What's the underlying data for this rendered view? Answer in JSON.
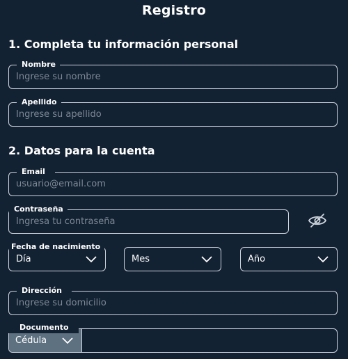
{
  "header": {
    "title": "Registro"
  },
  "sections": {
    "personal": "1. Completa tu información personal",
    "account": "2. Datos para la cuenta"
  },
  "fields": {
    "nombre": {
      "label": "Nombre",
      "placeholder": "Ingrese su nombre"
    },
    "apellido": {
      "label": "Apellido",
      "placeholder": "Ingrese su apellido"
    },
    "email": {
      "label": "Email",
      "placeholder": "usuario@email.com"
    },
    "password": {
      "label": "Contraseña",
      "placeholder": "Ingresa tu contraseña"
    },
    "birth": {
      "label": "Fecha de nacimiento",
      "day": "Día",
      "month": "Mes",
      "year": "Año"
    },
    "address": {
      "label": "Dirección",
      "placeholder": "Ingrese su domicilio"
    },
    "document": {
      "label": "Documento",
      "type": "Cédula",
      "value": ""
    }
  },
  "icons": {
    "password_toggle": "eye-slash-icon",
    "dropdown": "chevron-down-icon"
  },
  "colors": {
    "background": "#132233",
    "border": "#cfd6dd",
    "placeholder": "#7c8894",
    "select_fill": "#5e7180"
  }
}
